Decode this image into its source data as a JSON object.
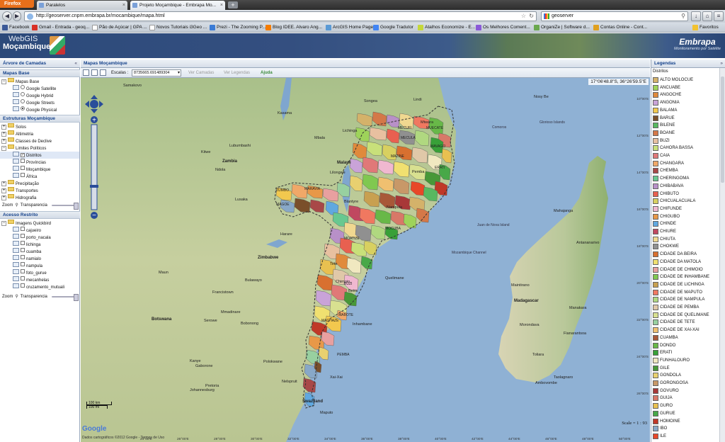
{
  "browser": {
    "menu_button": "Firefox",
    "tabs": [
      {
        "title": "Paralelos"
      },
      {
        "title": "Projeto Moçambique - Embrapa Mo..."
      }
    ],
    "url": "http://geoserver.cnpm.embrapa.br/mocambique/mapa.html",
    "search_value": "geoserver",
    "bookmarks": [
      {
        "label": "Facebook",
        "color": "#3b5998"
      },
      {
        "label": "Gmail - Entrada - geoq...",
        "color": "#d93025"
      },
      {
        "label": "Pão de Açúcar | GPA ...",
        "color": "#ffffff"
      },
      {
        "label": "Novos Tutoriais i3Geo ...",
        "color": "#ffffff"
      },
      {
        "label": "Prezi - The Zooming P...",
        "color": "#3a7bd5"
      },
      {
        "label": "Blog IDEE. Alvaro Ang...",
        "color": "#f57c00"
      },
      {
        "label": "ArcGIS Home Page",
        "color": "#5a9ad5"
      },
      {
        "label": "Google Tradutor",
        "color": "#4285f4"
      },
      {
        "label": "Atalhos Economize - E...",
        "color": "#c5d83a"
      },
      {
        "label": "Os Melhores Coment...",
        "color": "#8a5ad8"
      },
      {
        "label": "OrganiZe | Software d...",
        "color": "#6aa84f"
      },
      {
        "label": "Contas Online - Cont...",
        "color": "#e0a020"
      }
    ],
    "favoritos": "Favoritos"
  },
  "app": {
    "logo_line1": "WebGIS",
    "logo_line2": "Moçambique",
    "partner_name": "Embrapa",
    "partner_tagline": "Monitoramento por Satélite"
  },
  "left": {
    "title": "Árvore de Camadas",
    "mapas_base": {
      "title": "Mapas Base",
      "folder": "Mapas Base",
      "items": [
        "Google Satellite",
        "Google Hybrid",
        "Google Streets",
        "Google Physical"
      ]
    },
    "estruturas": {
      "title": "Estruturas Moçambique",
      "folders": [
        "Solos",
        "Altimetria",
        "Classes de Declive",
        "Limites Políticos"
      ],
      "limites": [
        "Distritos",
        "Províncias",
        "Moçambique",
        "África"
      ],
      "folders2": [
        "Precipitação",
        "Transportes",
        "Hidrografia"
      ]
    },
    "zoom_label": "Zoom",
    "transparencia": "Transparencia",
    "acesso": {
      "title": "Acesso Restrito",
      "folder": "Imagens Quickbird",
      "items": [
        "cajueiro",
        "porto_nacala",
        "lichinga",
        "cuamba",
        "namialo",
        "nampula",
        "foto_gurue",
        "mecanhelas",
        "cruzamento_mutuali"
      ]
    }
  },
  "center": {
    "title": "Mapas Moçambique",
    "escalas_label": "Escalas :",
    "escalas_value": "8735665.691489304",
    "ver_camadas": "Ver Camadas",
    "ver_legendas": "Ver Legendas",
    "ajuda": "Ajuda",
    "coords": "17°06'48.8\"S, 36°26'59.5\"E",
    "scale_text": "Scale = 1 : 93",
    "scalebar_km": "100 km",
    "scalebar_mi": "100 mi",
    "google": "Google",
    "copyright": "Dados cartográficos ©2012 Google - Termos de Uso",
    "land_color": "#c9d3a8",
    "sea_color": "#8fb1d4",
    "map_labels": {
      "cities": [
        "Samakovo",
        "Zambia",
        "Lubumbashi",
        "Kasama",
        "Malawi",
        "Lusaka",
        "Lilongwe",
        "Blantyre",
        "Harare",
        "Zimbabwe",
        "Bulawayo",
        "Maun",
        "Botswana",
        "Francistown",
        "Gaborone",
        "Pretoria",
        "Johannesburg",
        "Swaziland",
        "Madagascar",
        "Antananarivo",
        "Toliara",
        "Mahajanga",
        "Nosy Be",
        "Comoros",
        "Glorioso Islands",
        "Juan de Nova Island",
        "Mozambique Channel",
        "Serowe",
        "Mmadinare",
        "Bobonong",
        "Kanye",
        "Polokwane",
        "Nelspruit",
        "Fianarantsoa",
        "Ambovombe",
        "Taolagnaro",
        "Mbala",
        "Kitwe",
        "Ndola",
        "Songea",
        "Lindi",
        "Mtwara",
        "Tete",
        "Chimoio",
        "Beira",
        "Quelimane",
        "Nampula",
        "Lichinga",
        "Pemba",
        "Inhambane",
        "Xai-Xai",
        "Maputo",
        "Manakara",
        "Morondava",
        "Maintirano"
      ],
      "lat": [
        "10°00'S",
        "12°00'S",
        "14°00'S",
        "16°00'S",
        "18°00'S",
        "20°00'S",
        "22°00'S",
        "24°00'S",
        "26°00'S"
      ],
      "lon": [
        "24°00'E",
        "26°00'E",
        "28°00'E",
        "30°00'E",
        "32°00'E",
        "34°00'E",
        "36°00'E",
        "38°00'E",
        "40°00'E",
        "42°00'E",
        "44°00'E",
        "46°00'E",
        "48°00'E",
        "50°00'E"
      ]
    },
    "province_labels": [
      "MUECATE",
      "MECUFI",
      "MECULA",
      "MAVAGO",
      "MAZINE",
      "ERATI",
      "ZUMBO",
      "MARAVIA",
      "MAGOE",
      "MOATIZE",
      "BUZI",
      "MACHAZE",
      "MABOTE",
      "MOCUBA",
      "PEMBA"
    ]
  },
  "legend": {
    "title": "Legendas",
    "layer": "Distritos",
    "items": [
      {
        "name": "ALTO MOLOCUE",
        "color": "#d4b26a"
      },
      {
        "name": "ANCUABE",
        "color": "#9ed35a"
      },
      {
        "name": "ANGOCHE",
        "color": "#e08a3c"
      },
      {
        "name": "ANGONIA",
        "color": "#c9a3d8"
      },
      {
        "name": "BALAMA",
        "color": "#f2c84e"
      },
      {
        "name": "BARUE",
        "color": "#7a4f2a"
      },
      {
        "name": "BILENE",
        "color": "#58b860"
      },
      {
        "name": "BOANE",
        "color": "#d47848"
      },
      {
        "name": "BUZI",
        "color": "#e8c0a0"
      },
      {
        "name": "CAHORA BASSA",
        "color": "#c8e07a"
      },
      {
        "name": "CAIA",
        "color": "#e07878"
      },
      {
        "name": "CHANGARA",
        "color": "#f0a868"
      },
      {
        "name": "CHEMBA",
        "color": "#a84848"
      },
      {
        "name": "CHERINGOMA",
        "color": "#68c890"
      },
      {
        "name": "CHIBABAVA",
        "color": "#b890c8"
      },
      {
        "name": "CHIBUTO",
        "color": "#e86050"
      },
      {
        "name": "CHICUALACUALA",
        "color": "#d8d060"
      },
      {
        "name": "CHIFUNDE",
        "color": "#f0b8d0"
      },
      {
        "name": "CHIGUBO",
        "color": "#e89848"
      },
      {
        "name": "CHINDE",
        "color": "#60a8e0"
      },
      {
        "name": "CHIURE",
        "color": "#c04860"
      },
      {
        "name": "CHIUTA",
        "color": "#f0d890"
      },
      {
        "name": "CHOKWE",
        "color": "#909090"
      },
      {
        "name": "CIDADE DA BEIRA",
        "color": "#d87030"
      },
      {
        "name": "CIDADE DA MATOLA",
        "color": "#f0e070"
      },
      {
        "name": "CIDADE DE CHIMOIO",
        "color": "#e8a0a0"
      },
      {
        "name": "CIDADE DE INHAMBANE",
        "color": "#80c850"
      },
      {
        "name": "CIDADE DE LICHINGA",
        "color": "#c8a050"
      },
      {
        "name": "CIDADE DE MAPUTO",
        "color": "#f07860"
      },
      {
        "name": "CIDADE DE NAMPULA",
        "color": "#b0d880"
      },
      {
        "name": "CIDADE DE PEMBA",
        "color": "#e0c8a8"
      },
      {
        "name": "CIDADE DE QUELIMANE",
        "color": "#d8e090"
      },
      {
        "name": "CIDADE DE TETE",
        "color": "#98d0a0"
      },
      {
        "name": "CIDADE DE XAI-XAI",
        "color": "#f0c070"
      },
      {
        "name": "CUAMBA",
        "color": "#a85838"
      },
      {
        "name": "DONDO",
        "color": "#68b848"
      },
      {
        "name": "ERATI",
        "color": "#38a038"
      },
      {
        "name": "FUNHALOURO",
        "color": "#f0e8c0"
      },
      {
        "name": "GILE",
        "color": "#489838"
      },
      {
        "name": "GONDOLA",
        "color": "#e8d070"
      },
      {
        "name": "GORONGOSA",
        "color": "#c89868"
      },
      {
        "name": "GOVURO",
        "color": "#a83838"
      },
      {
        "name": "GUIJA",
        "color": "#d87868"
      },
      {
        "name": "GURO",
        "color": "#e8c050"
      },
      {
        "name": "GURUE",
        "color": "#48a848"
      },
      {
        "name": "HOMOINE",
        "color": "#c03828"
      },
      {
        "name": "IBO",
        "color": "#88a8c8"
      },
      {
        "name": "ILE",
        "color": "#e84828"
      }
    ]
  }
}
